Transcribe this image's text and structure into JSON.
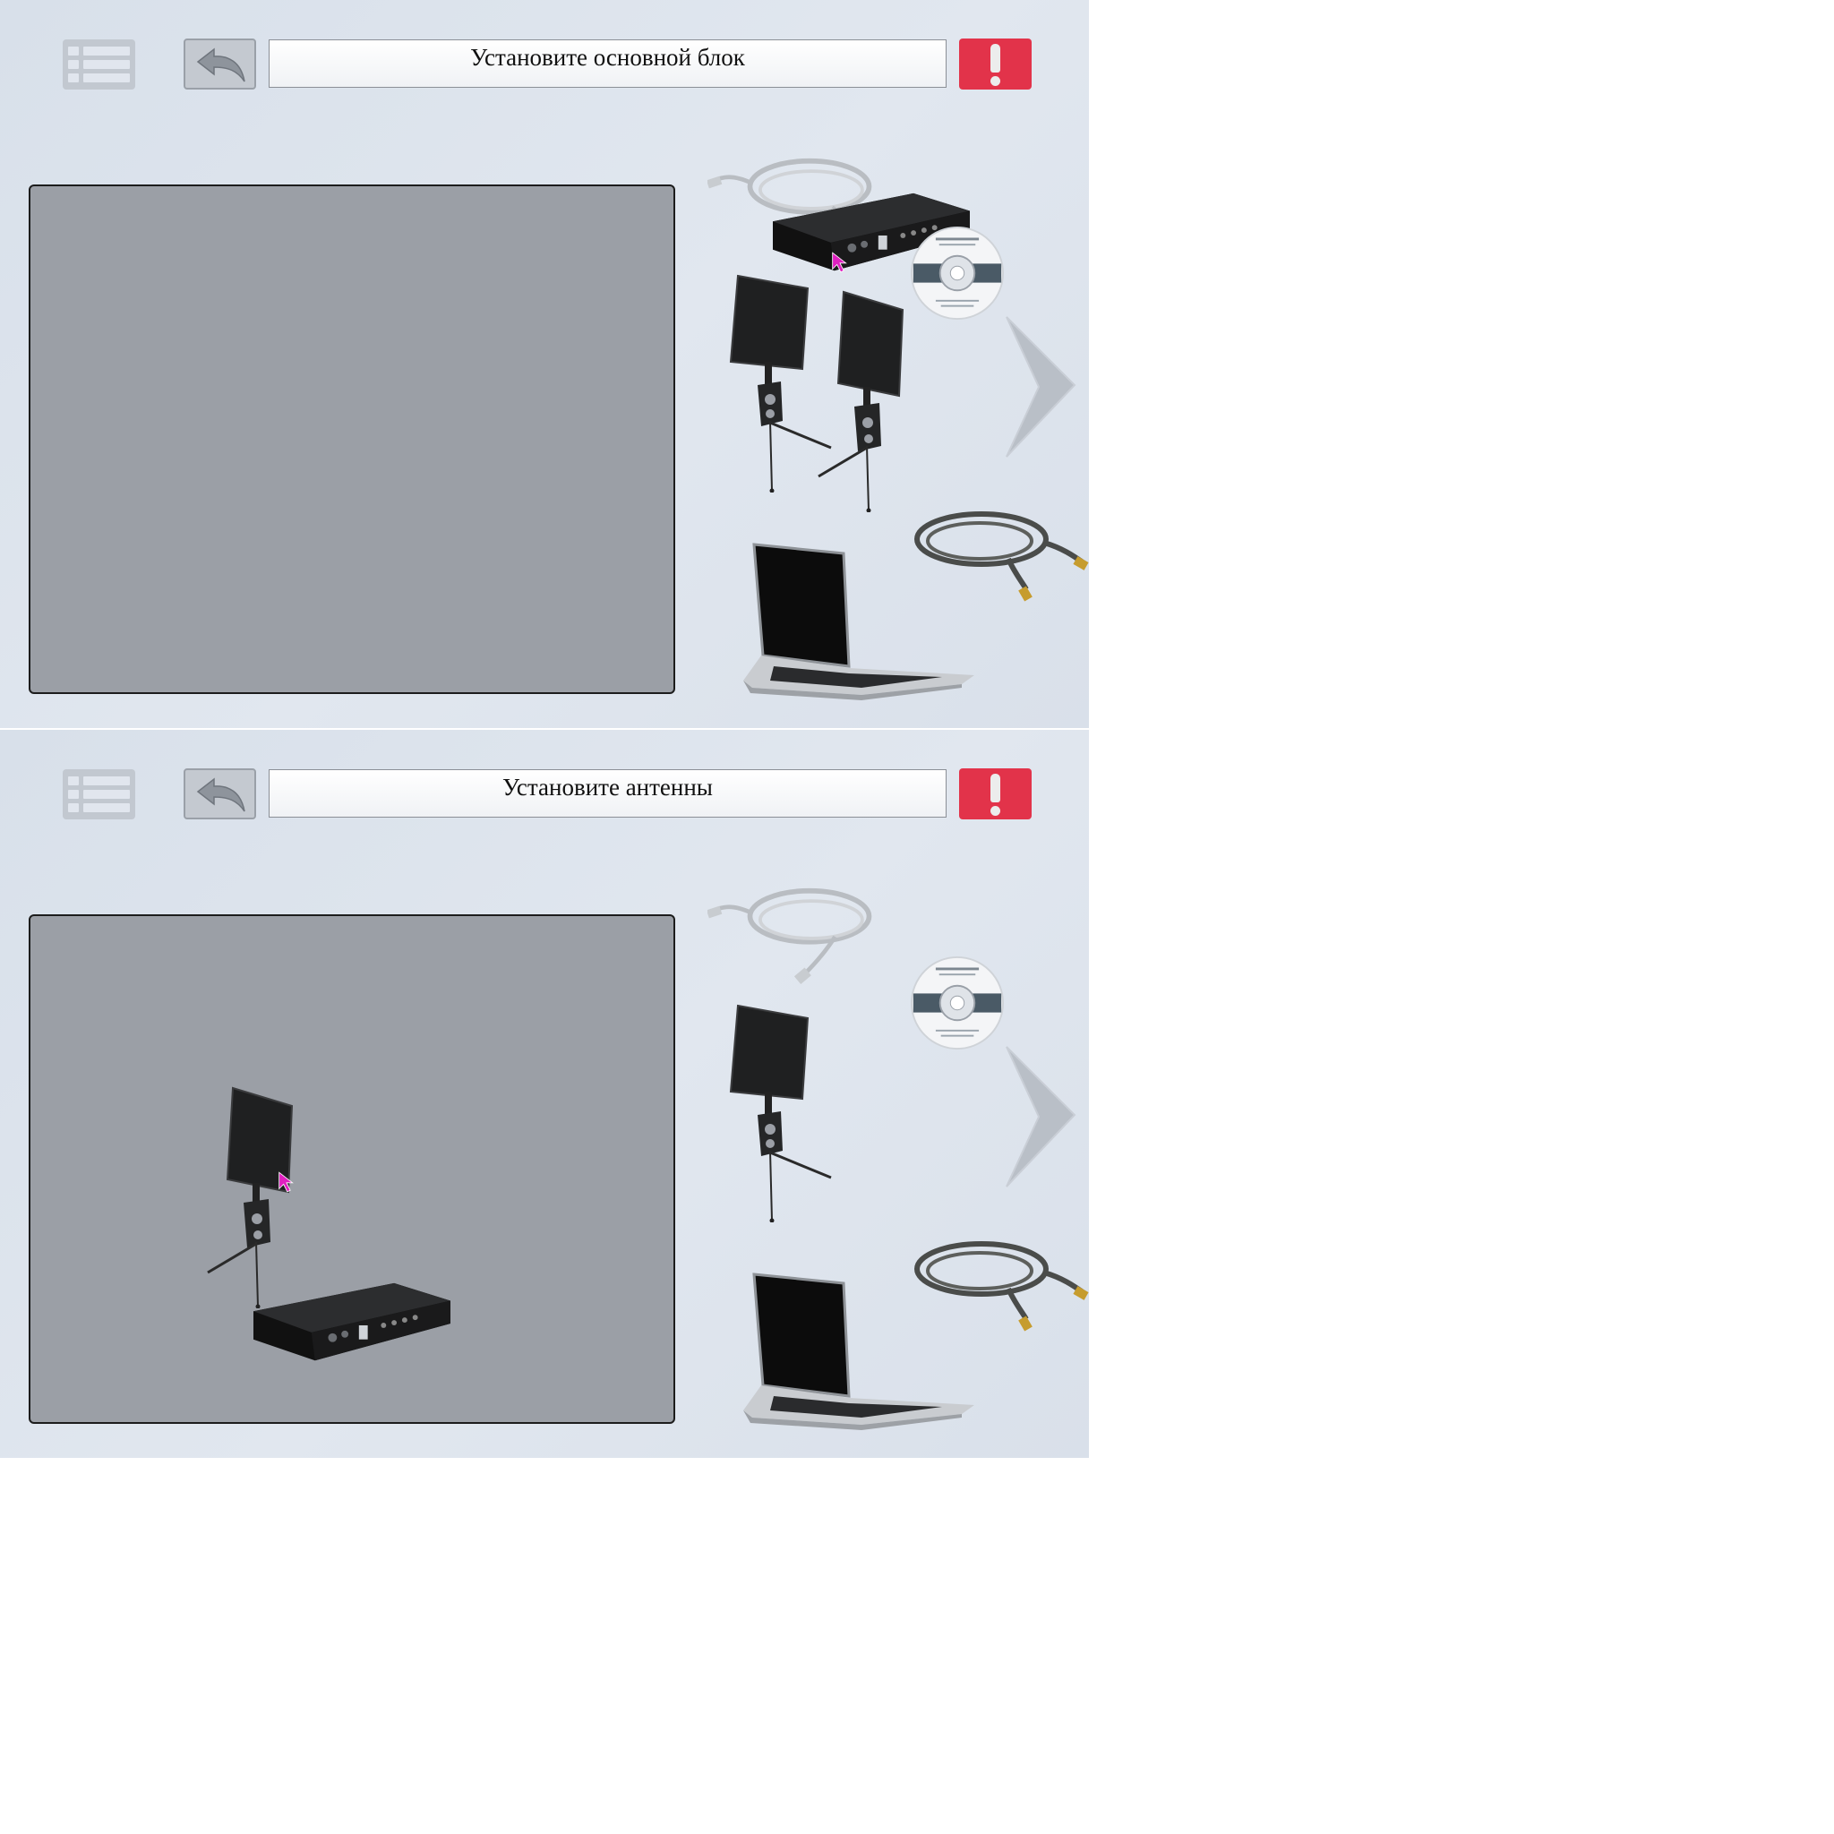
{
  "panels": [
    {
      "instruction": "Установите основной блок"
    },
    {
      "instruction": "Установите антенны"
    }
  ],
  "palette": {
    "items": [
      "ethernet-cable",
      "receiver-unit",
      "software-cd",
      "antenna",
      "antenna",
      "coax-cable",
      "laptop"
    ]
  },
  "colors": {
    "background": "#dde3ec",
    "work_area": "#9b9fa6",
    "alert": "#e2334a",
    "cursor": "#e020c0"
  }
}
